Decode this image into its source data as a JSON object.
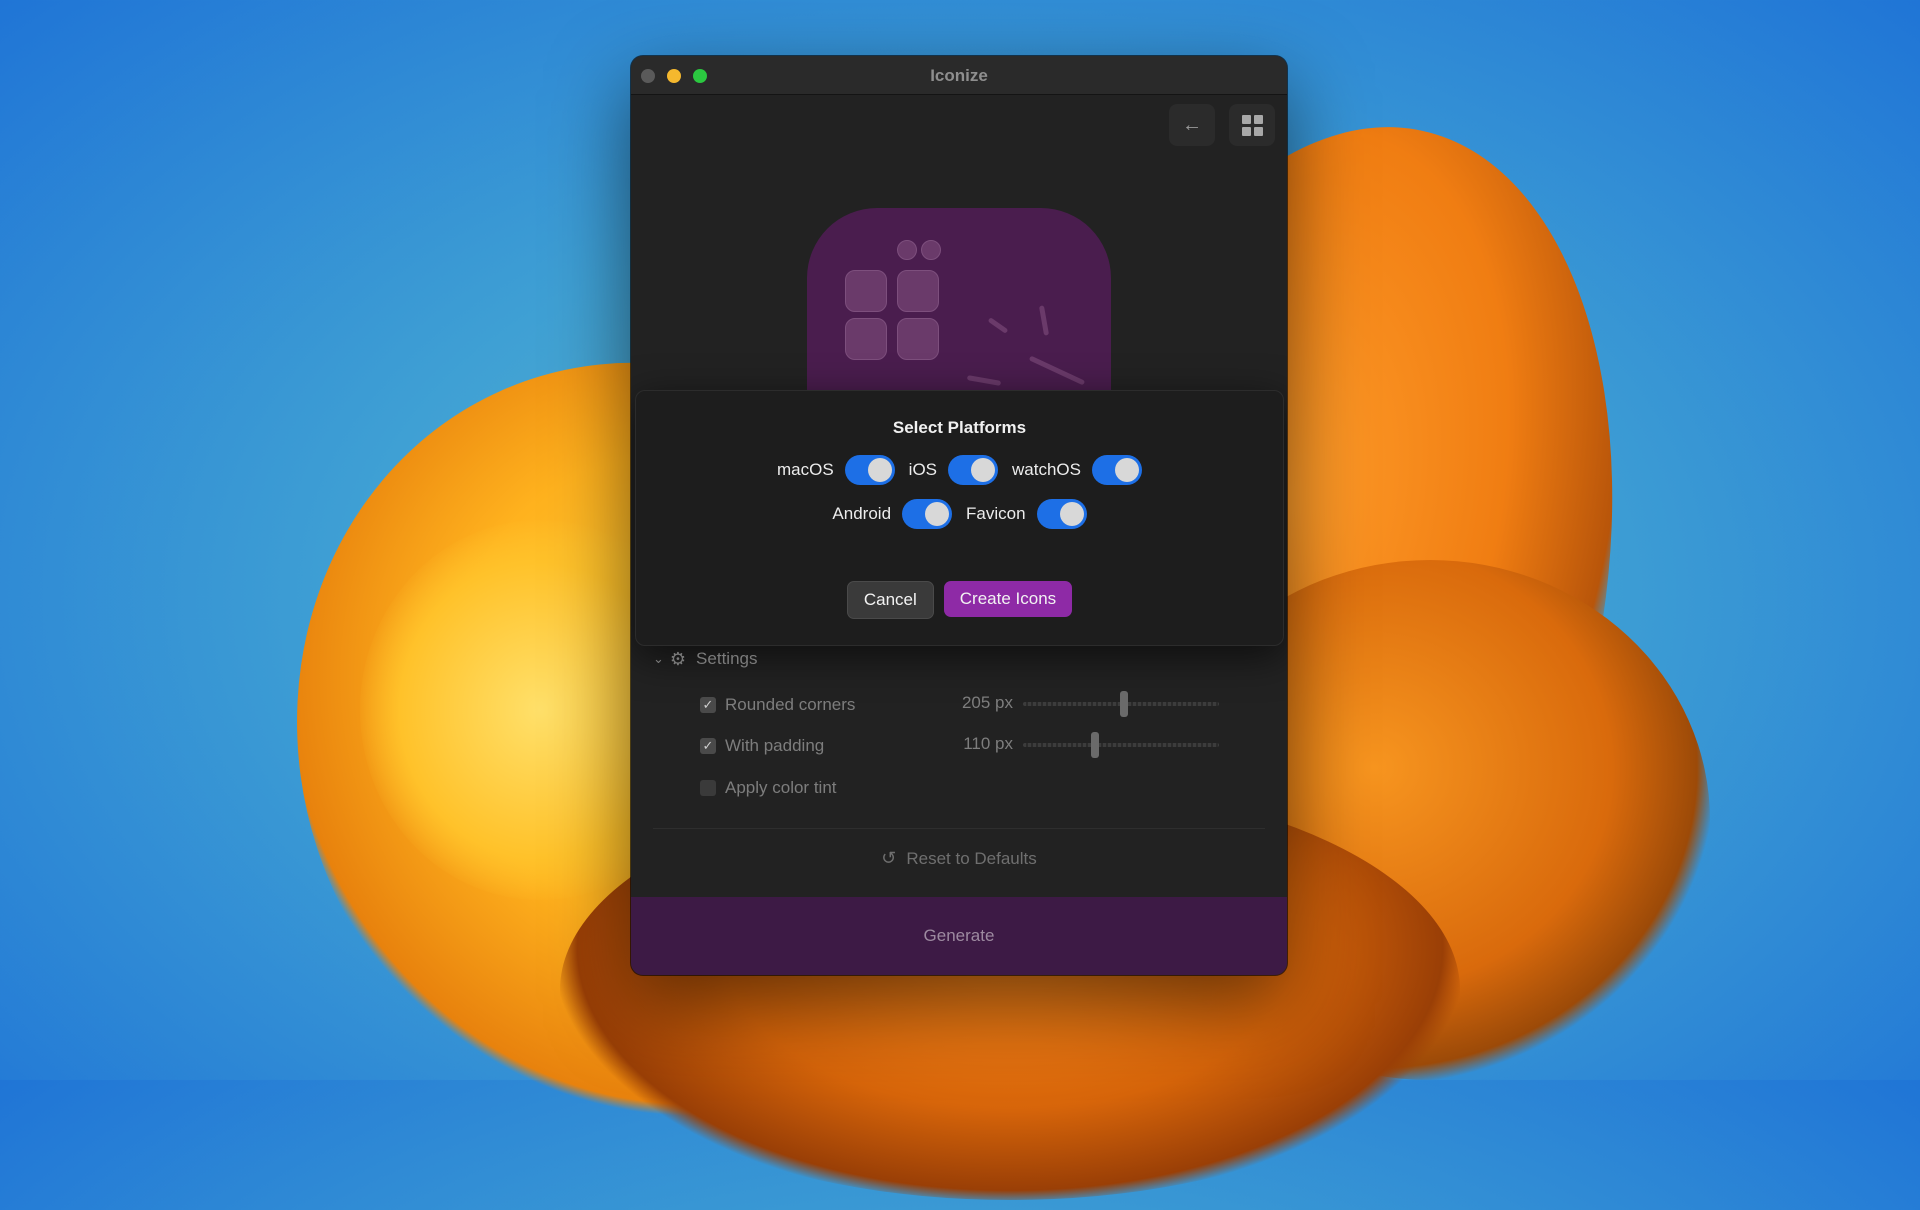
{
  "app": {
    "title": "Iconize"
  },
  "toolbar": {
    "back_icon": "arrow-left-icon",
    "grid_icon": "grid-icon"
  },
  "dialog": {
    "title": "Select Platforms",
    "platforms": [
      {
        "label": "macOS",
        "enabled": true
      },
      {
        "label": "iOS",
        "enabled": true
      },
      {
        "label": "watchOS",
        "enabled": true
      },
      {
        "label": "Android",
        "enabled": true
      },
      {
        "label": "Favicon",
        "enabled": true
      }
    ],
    "cancel_label": "Cancel",
    "create_label": "Create Icons"
  },
  "settings": {
    "header": "Settings",
    "rounded_corners": {
      "label": "Rounded corners",
      "checked": true,
      "value": "205 px"
    },
    "with_padding": {
      "label": "With padding",
      "checked": true,
      "value": "110 px"
    },
    "color_tint": {
      "label": "Apply color tint",
      "checked": false
    },
    "reset_label": "Reset to Defaults"
  },
  "generate_label": "Generate",
  "colors": {
    "accent": "#8e2aa6",
    "toggle_on": "#1d6fe6",
    "generate_bg": "#3d1a45",
    "icon_bg": "#4a1d4e"
  }
}
